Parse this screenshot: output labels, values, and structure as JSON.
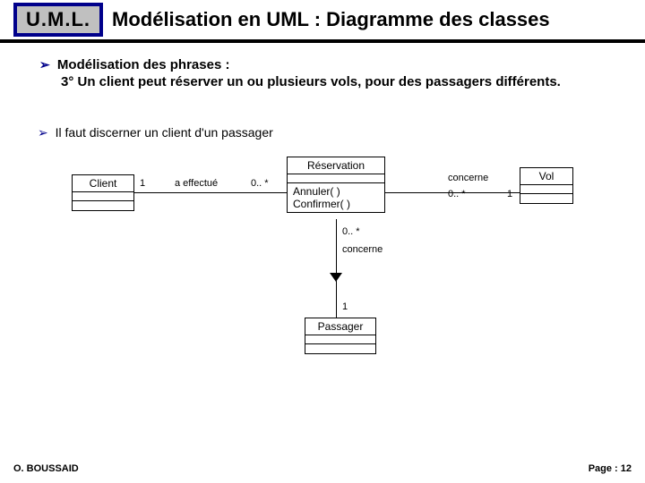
{
  "header": {
    "logo": "U.M.L.",
    "title": "Modélisation en UML : Diagramme des classes"
  },
  "body": {
    "bullet1": "Modélisation des phrases :",
    "phrase": "3° Un client peut réserver un ou plusieurs vols, pour des passagers différents.",
    "bullet2": "Il faut discerner un client d'un passager"
  },
  "diagram": {
    "client": {
      "name": "Client"
    },
    "reservation": {
      "name": "Réservation",
      "op1": "Annuler( )",
      "op2": "Confirmer( )"
    },
    "vol": {
      "name": "Vol"
    },
    "passager": {
      "name": "Passager"
    },
    "assoc_client_res": {
      "label": "a effectué",
      "mult_left": "1",
      "mult_right": "0.. *"
    },
    "assoc_res_vol": {
      "label": "concerne",
      "mult_left": "0.. *",
      "mult_right": "1"
    },
    "assoc_res_pass": {
      "label": "concerne",
      "mult_top": "0.. *",
      "mult_bottom": "1"
    }
  },
  "footer": {
    "author": "O. BOUSSAID",
    "page": "Page : 12"
  }
}
